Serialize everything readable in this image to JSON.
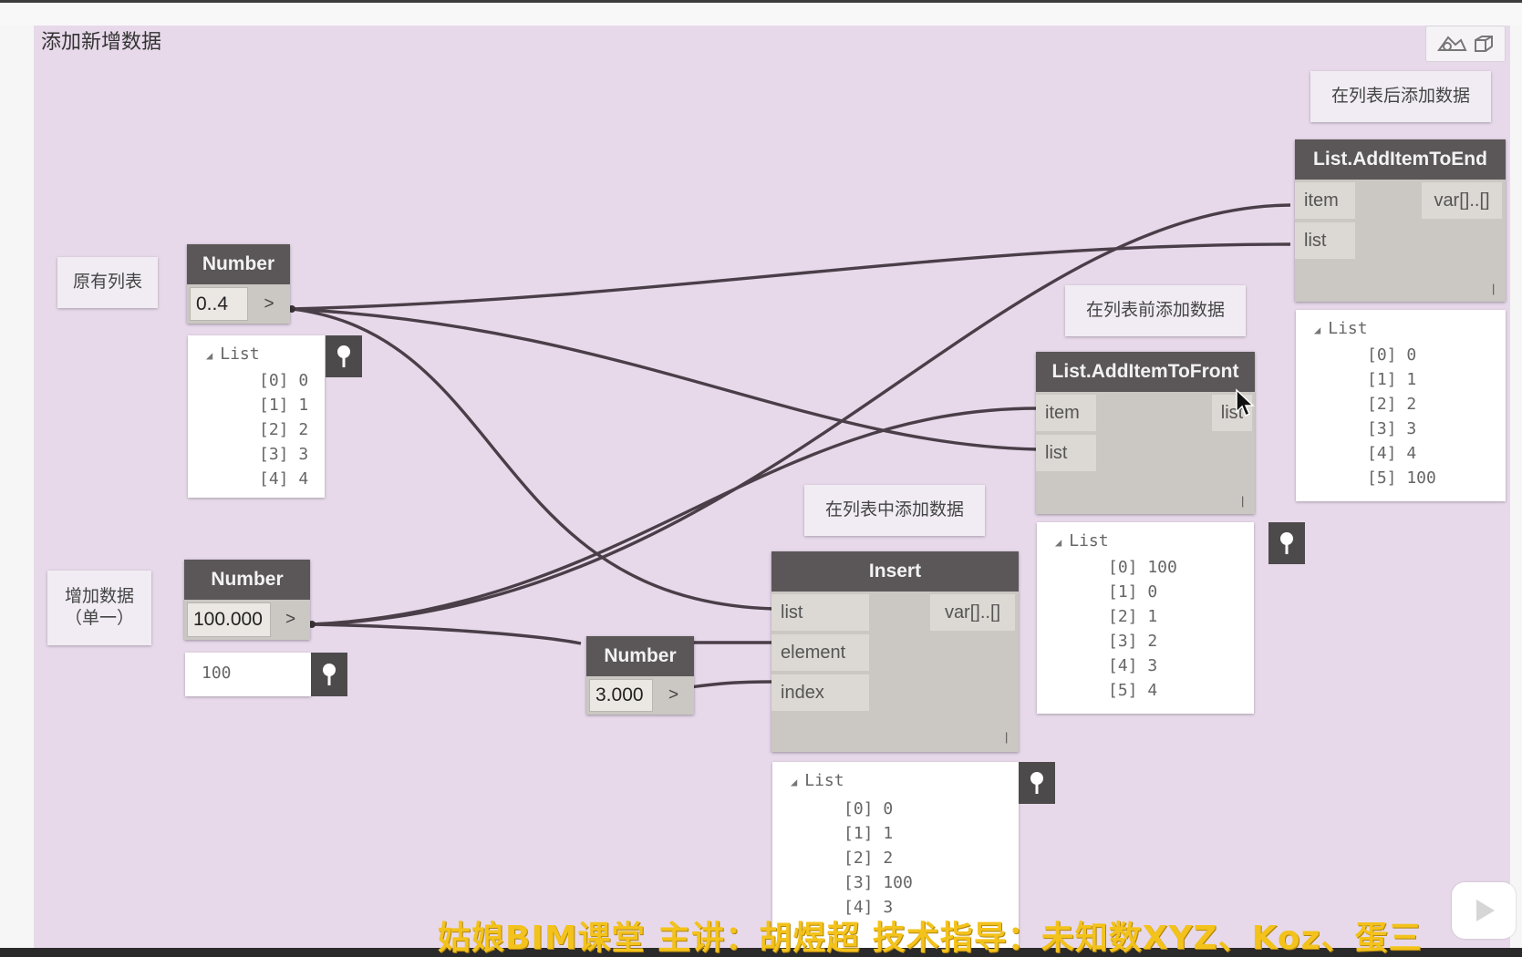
{
  "group": {
    "title": "添加新增数据"
  },
  "notes": {
    "original_list": "原有列表",
    "add_data": "增加数据\n（单一）",
    "add_to_end": "在列表后添加数据",
    "add_to_front": "在列表前添加数据",
    "insert_middle": "在列表中添加数据"
  },
  "nodes": {
    "number1": {
      "title": "Number",
      "value": "0..4",
      "arrow": ">"
    },
    "number2": {
      "title": "Number",
      "value": "100.000",
      "arrow": ">"
    },
    "number3": {
      "title": "Number",
      "value": "3.000",
      "arrow": ">"
    },
    "insert": {
      "title": "Insert",
      "inputs": [
        "list",
        "element",
        "index"
      ],
      "output": "var[]..[]"
    },
    "add_to_front": {
      "title": "List.AddItemToFront",
      "inputs": [
        "item",
        "list"
      ],
      "output": "list"
    },
    "add_to_end": {
      "title": "List.AddItemToEnd",
      "inputs": [
        "item",
        "list"
      ],
      "output": "var[]..[]"
    }
  },
  "previews": {
    "number1": {
      "head": "List",
      "items": [
        "[0] 0",
        "[1] 1",
        "[2] 2",
        "[3] 3",
        "[4] 4"
      ]
    },
    "number2": {
      "value": "100"
    },
    "insert": {
      "head": "List",
      "items": [
        "[0] 0",
        "[1] 1",
        "[2] 2",
        "[3] 100",
        "[4] 3"
      ]
    },
    "add_to_front": {
      "head": "List",
      "items": [
        "[0] 100",
        "[1] 0",
        "[2] 1",
        "[3] 2",
        "[4] 3",
        "[5] 4"
      ]
    },
    "add_to_end": {
      "head": "List",
      "items": [
        "[0] 0",
        "[1] 1",
        "[2] 2",
        "[3] 3",
        "[4] 4",
        "[5] 100"
      ]
    }
  },
  "overlay": {
    "subtitle": "姑娘BIM课堂  主讲：胡煜超  技术指导：未知数XYZ、Koz、蛋三"
  },
  "colors": {
    "canvas": "#e7d9ea",
    "node_header": "#5b5658",
    "node_body": "#cbc7c2",
    "wire": "#4a3f48",
    "subtitle": "#f3c21b"
  }
}
